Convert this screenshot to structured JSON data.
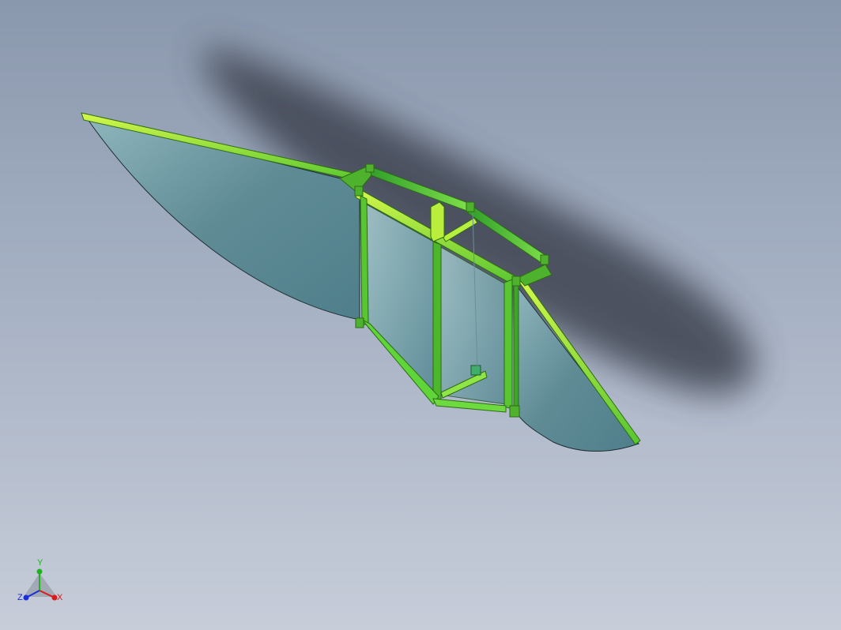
{
  "viewport": {
    "background_top": "#8a98ad",
    "background_bottom": "#c7cdd9"
  },
  "model": {
    "frame_color": "#5fd53a",
    "frame_highlight": "#c8f03a",
    "frame_edge": "#2d6b14",
    "panel_color": "#5e8a94",
    "shadow_color": "#3d4350"
  },
  "triad": {
    "x_label": "X",
    "y_label": "Y",
    "z_label": "Z",
    "x_color": "#d81b1b",
    "y_color": "#1fb31f",
    "z_color": "#1b2fd8"
  }
}
